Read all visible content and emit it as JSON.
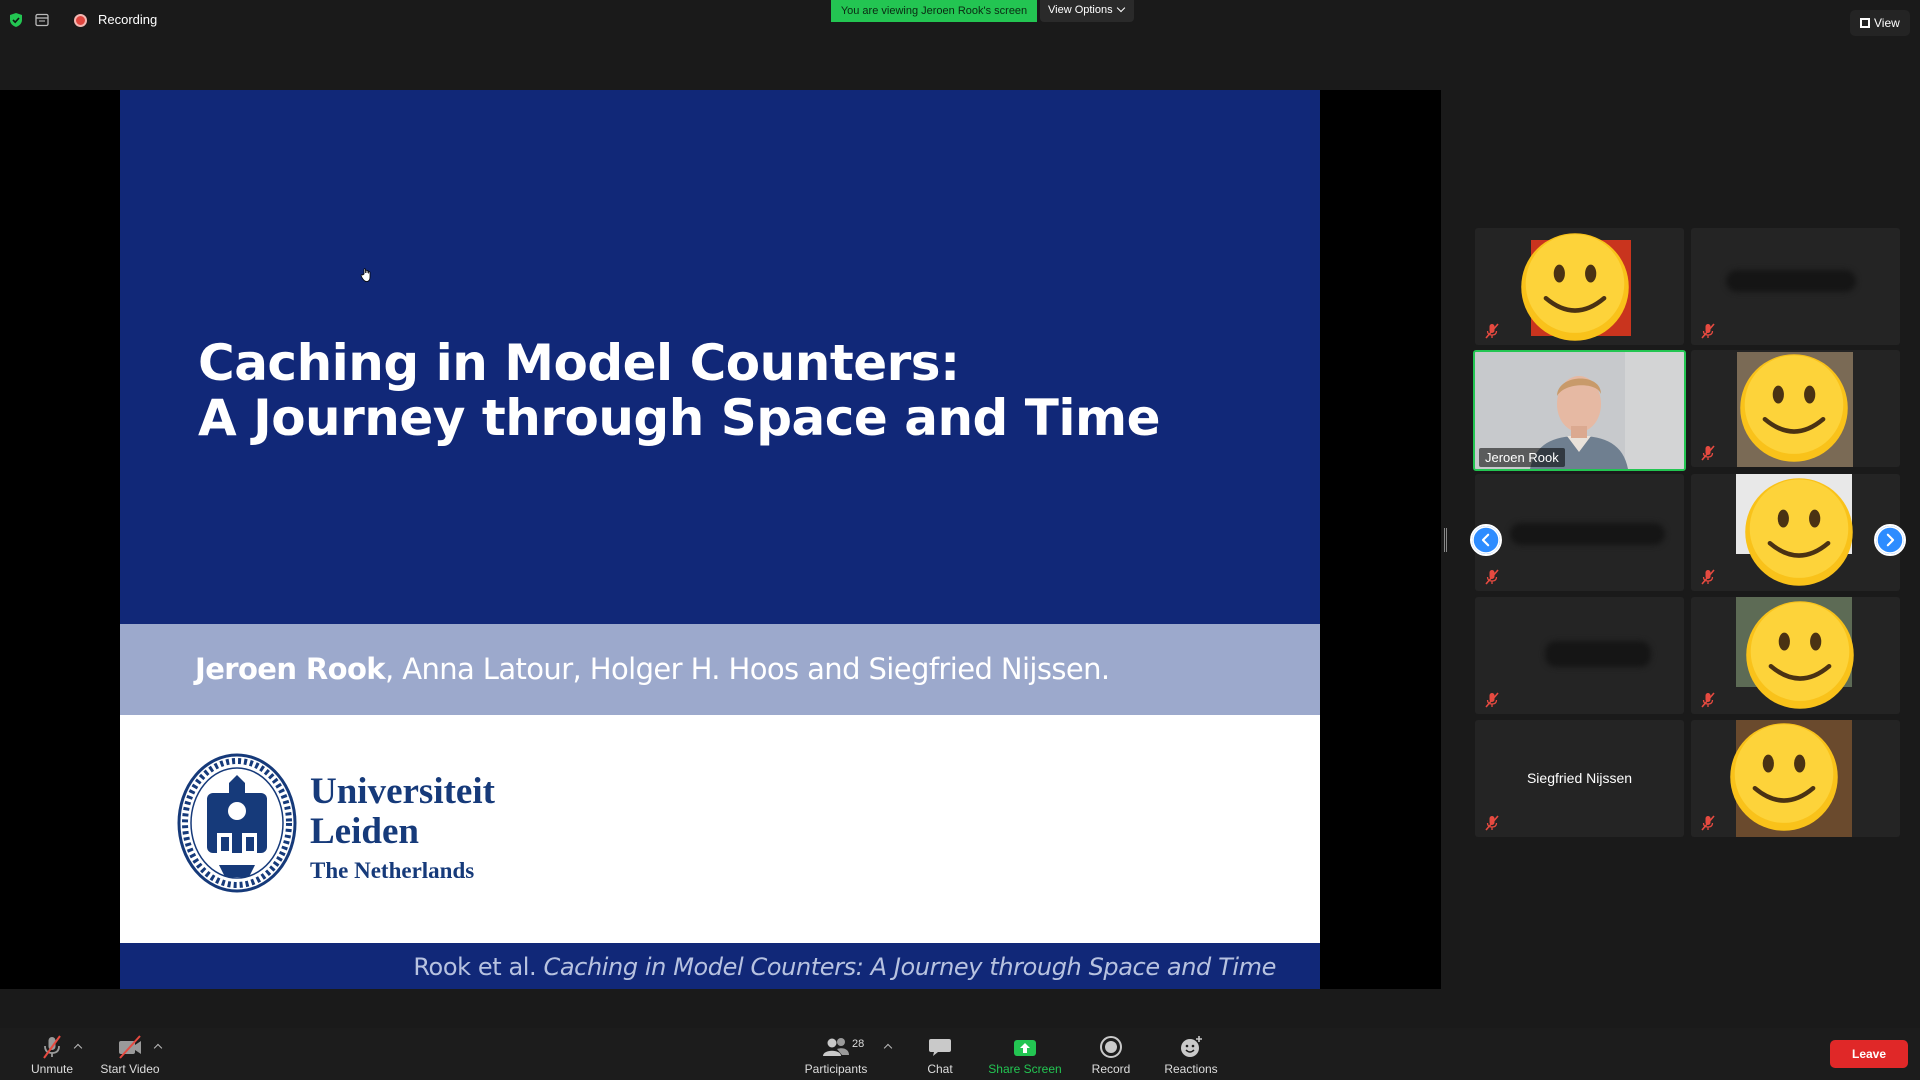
{
  "topbar": {
    "recording_label": "Recording",
    "viewing_banner": "You are viewing Jeroen Rook's screen",
    "view_options_label": "View Options",
    "view_label": "View"
  },
  "slide": {
    "title_line1": "Caching in Model Counters:",
    "title_line2": "A Journey through Space and Time",
    "author_main": "Jeroen Rook",
    "authors_rest": ", Anna Latour, Holger H. Hoos and Siegfried Nijssen.",
    "logo_line1": "Universiteit",
    "logo_line2": "Leiden",
    "logo_line3": "The Netherlands",
    "footer_prefix": "Rook et al. ",
    "footer_title": "Caching in Model Counters: A Journey through Space and Time"
  },
  "gallery": {
    "active_speaker": "Jeroen Rook",
    "camera_off_name": "Siegfried Nijssen",
    "tiles": [
      "emoji",
      "blank",
      "video-jeroen",
      "emoji",
      "blank",
      "emoji",
      "blank",
      "emoji",
      "name-only",
      "emoji"
    ]
  },
  "toolbar": {
    "unmute": "Unmute",
    "start_video": "Start Video",
    "participants": "Participants",
    "participants_count": "28",
    "chat": "Chat",
    "share_screen": "Share Screen",
    "record": "Record",
    "reactions": "Reactions",
    "leave": "Leave"
  },
  "colors": {
    "accent_green": "#23c552",
    "slide_blue": "#112878",
    "leave_red": "#e02828",
    "nav_blue": "#2d8cff"
  }
}
